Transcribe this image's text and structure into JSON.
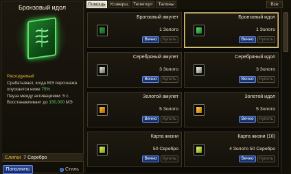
{
  "detail": {
    "title": "Бронзовый идол",
    "desc_head": "Расходуемый",
    "desc_line1": "Срабатывает, когда МЭ персонажа",
    "desc_line2a": "опускается ниже ",
    "desc_line2b": "75%",
    "desc_line3": "Пауза между активациями: 5 с.",
    "desc_line4a": "Восстанавливает до ",
    "desc_line4b": "150,000",
    "desc_line4c": " МЭ",
    "price_label": "Слитки",
    "price_value": "7 Серебро",
    "fill_button": "Пополнить",
    "style_button": "Стиль"
  },
  "tabs": [
    {
      "label": "Помощь"
    },
    {
      "label": "Усоверш."
    },
    {
      "label": "Телепорт"
    },
    {
      "label": "Талоны"
    }
  ],
  "tab_all": "Все",
  "cards": [
    {
      "name": "Бронзовый амулет",
      "price": "1 Золото"
    },
    {
      "name": "Бронзовый идол",
      "price": "1 Золото"
    },
    {
      "name": "Серебряный амулет",
      "price": "3 Золото"
    },
    {
      "name": "Серебряный идол",
      "price": "3 Золото"
    },
    {
      "name": "Золотой амулет",
      "price": "5 Золото"
    },
    {
      "name": "Золотой идол",
      "price": "5 Золото"
    },
    {
      "name": "Карта жизни",
      "price": "50 Серебро"
    },
    {
      "name": "Карта жизни (10)",
      "price": "4 Золото 50 Серебро"
    }
  ],
  "buttons": {
    "forever": "Вечно",
    "buy": "Купить"
  },
  "colors": {
    "accent_gold": "#e8b830",
    "green_value": "#60d868",
    "button_blue": "#234894"
  }
}
